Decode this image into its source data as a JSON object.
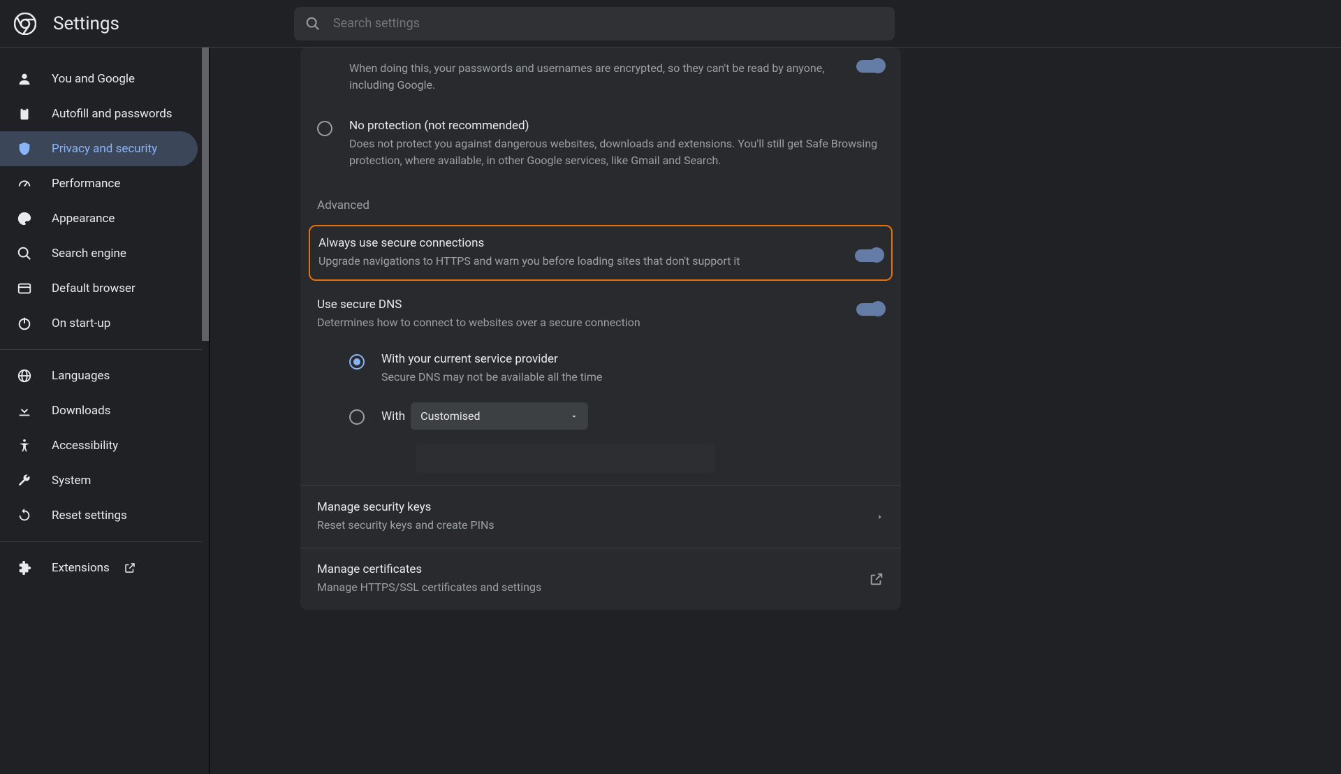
{
  "header": {
    "title": "Settings",
    "search_placeholder": "Search settings"
  },
  "sidebar": {
    "items": [
      {
        "label": "You and Google"
      },
      {
        "label": "Autofill and passwords"
      },
      {
        "label": "Privacy and security"
      },
      {
        "label": "Performance"
      },
      {
        "label": "Appearance"
      },
      {
        "label": "Search engine"
      },
      {
        "label": "Default browser"
      },
      {
        "label": "On start-up"
      }
    ],
    "items2": [
      {
        "label": "Languages"
      },
      {
        "label": "Downloads"
      },
      {
        "label": "Accessibility"
      },
      {
        "label": "System"
      },
      {
        "label": "Reset settings"
      }
    ],
    "items3": [
      {
        "label": "Extensions"
      }
    ]
  },
  "main": {
    "partial_desc": "When doing this, your passwords and usernames are encrypted, so they can't be read by anyone, including Google.",
    "no_protection": {
      "title": "No protection (not recommended)",
      "desc": "Does not protect you against dangerous websites, downloads and extensions. You'll still get Safe Browsing protection, where available, in other Google services, like Gmail and Search."
    },
    "advanced_label": "Advanced",
    "secure_conn": {
      "title": "Always use secure connections",
      "desc": "Upgrade navigations to HTTPS and warn you before loading sites that don't support it"
    },
    "secure_dns": {
      "title": "Use secure DNS",
      "desc": "Determines how to connect to websites over a secure connection"
    },
    "dns_provider": {
      "title": "With your current service provider",
      "desc": "Secure DNS may not be available all the time"
    },
    "dns_custom": {
      "label": "With",
      "dropdown": "Customised"
    },
    "security_keys": {
      "title": "Manage security keys",
      "desc": "Reset security keys and create PINs"
    },
    "certificates": {
      "title": "Manage certificates",
      "desc": "Manage HTTPS/SSL certificates and settings"
    }
  }
}
